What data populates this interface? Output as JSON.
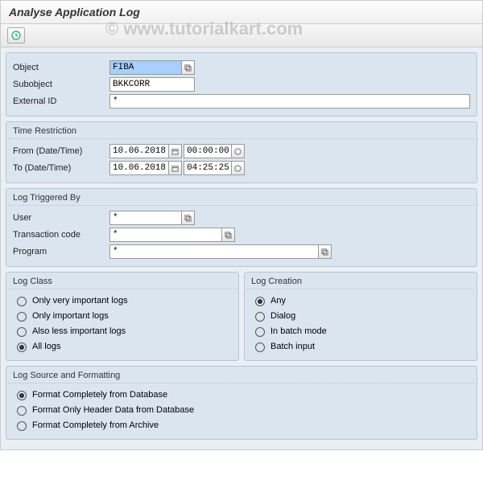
{
  "window": {
    "title": "Analyse Application Log"
  },
  "watermark": "© www.tutorialkart.com",
  "basic": {
    "object_label": "Object",
    "object_value": "FIBA",
    "subobject_label": "Subobject",
    "subobject_value": "BKKCORR",
    "external_id_label": "External ID",
    "external_id_value": "*"
  },
  "time_restriction": {
    "title": "Time Restriction",
    "from_label": "From (Date/Time)",
    "from_date": "10.06.2018",
    "from_time": "00:00:00",
    "to_label": "To (Date/Time)",
    "to_date": "10.06.2018",
    "to_time": "04:25:25"
  },
  "triggered_by": {
    "title": "Log Triggered By",
    "user_label": "User",
    "user_value": "*",
    "tcode_label": "Transaction code",
    "tcode_value": "*",
    "program_label": "Program",
    "program_value": "*"
  },
  "log_class": {
    "title": "Log Class",
    "options": {
      "very_important": "Only very important logs",
      "important": "Only important logs",
      "less_important": "Also less important logs",
      "all": "All logs"
    }
  },
  "log_creation": {
    "title": "Log Creation",
    "options": {
      "any": "Any",
      "dialog": "Dialog",
      "batch_mode": "In batch mode",
      "batch_input": "Batch input"
    }
  },
  "log_source": {
    "title": "Log Source and Formatting",
    "options": {
      "full_db": "Format Completely from Database",
      "header_db": "Format Only Header Data from Database",
      "full_archive": "Format Completely from Archive"
    }
  }
}
